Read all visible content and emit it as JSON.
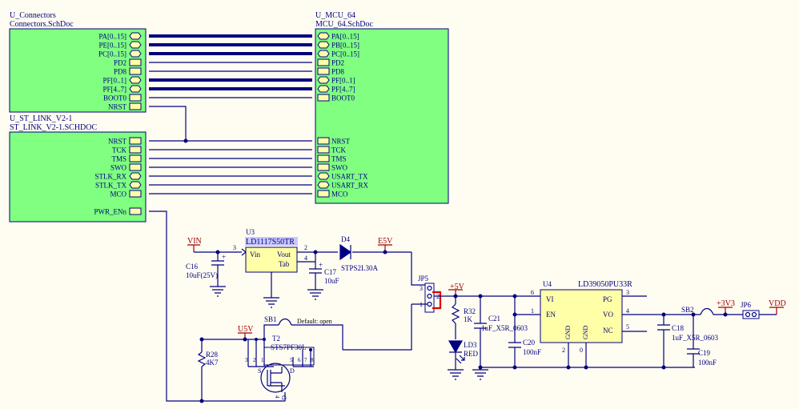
{
  "blocks": {
    "connectors": {
      "designator": "U_Connectors",
      "file": "Connectors.SchDoc",
      "ports": [
        "PA[0..15]",
        "PE[0..15]",
        "PC[0..15]",
        "PD2",
        "PD8",
        "PF[0..1]",
        "PF[4..7]",
        "BOOT0",
        "NRST"
      ]
    },
    "mcu": {
      "designator": "U_MCU_64",
      "file": "MCU_64.SchDoc",
      "ports_top": [
        "PA[0..15]",
        "PB[0..15]",
        "PC[0..15]",
        "PD2",
        "PD8",
        "PF[0..1]",
        "PF[4..7]",
        "BOOT0"
      ],
      "ports_bottom": [
        "NRST",
        "TCK",
        "TMS",
        "SWO",
        "USART_TX",
        "USART_RX",
        "MCO"
      ]
    },
    "stlink": {
      "designator": "U_ST_LINK_V2-1",
      "file": "ST_LINK_V2-1.SCHDOC",
      "ports": [
        "NRST",
        "TCK",
        "TMS",
        "SWO",
        "STLK_RX",
        "STLK_TX",
        "MCO",
        "PWR_ENn"
      ]
    }
  },
  "power": {
    "vin": "VIN",
    "e5v": "E5V",
    "u5v": "U5V",
    "p5v": "+5V",
    "p3v3": "+3V3",
    "vdd": "VDD"
  },
  "parts": {
    "u3": {
      "ref": "U3",
      "value": "LD1117S50TR",
      "vin": "Vin",
      "vout": "Vout",
      "tab": "Tab",
      "pins": [
        "3",
        "2",
        "4"
      ]
    },
    "c16": {
      "ref": "C16",
      "value": "10uF(25V)"
    },
    "c17": {
      "ref": "C17",
      "value": "10uF"
    },
    "d4": {
      "ref": "D4",
      "value": "STPS2L30A"
    },
    "jp5": {
      "ref": "JP5",
      "pins": [
        "3",
        "2",
        "1"
      ]
    },
    "sb1": {
      "ref": "SB1",
      "note": "Default: open"
    },
    "t2": {
      "ref": "T2",
      "value": "STS7PF30L",
      "pins": [
        "5",
        "6",
        "7",
        "8",
        "3",
        "2",
        "1",
        "4"
      ],
      "s": "S",
      "d": "D",
      "g": "G"
    },
    "r28": {
      "ref": "R28",
      "value": "4K7"
    },
    "r32": {
      "ref": "R32",
      "value": "1K"
    },
    "ld3": {
      "ref": "LD3",
      "value": "RED"
    },
    "c21": {
      "ref": "C21",
      "value": "1uF_X5R_0603"
    },
    "c20": {
      "ref": "C20",
      "value": "100nF"
    },
    "u4": {
      "ref": "U4",
      "value": "LD39050PU33R",
      "vi": "VI",
      "en": "EN",
      "pg": "PG",
      "vo": "VO",
      "nc": "NC",
      "gnd": "GND",
      "pins": [
        "6",
        "1",
        "2",
        "0",
        "3",
        "4",
        "5"
      ]
    },
    "sb2": {
      "ref": "SB2"
    },
    "c18": {
      "ref": "C18",
      "value": "1uF_X5R_0603"
    },
    "c19": {
      "ref": "C19",
      "value": "100nF"
    },
    "jp6": {
      "ref": "JP6"
    }
  }
}
